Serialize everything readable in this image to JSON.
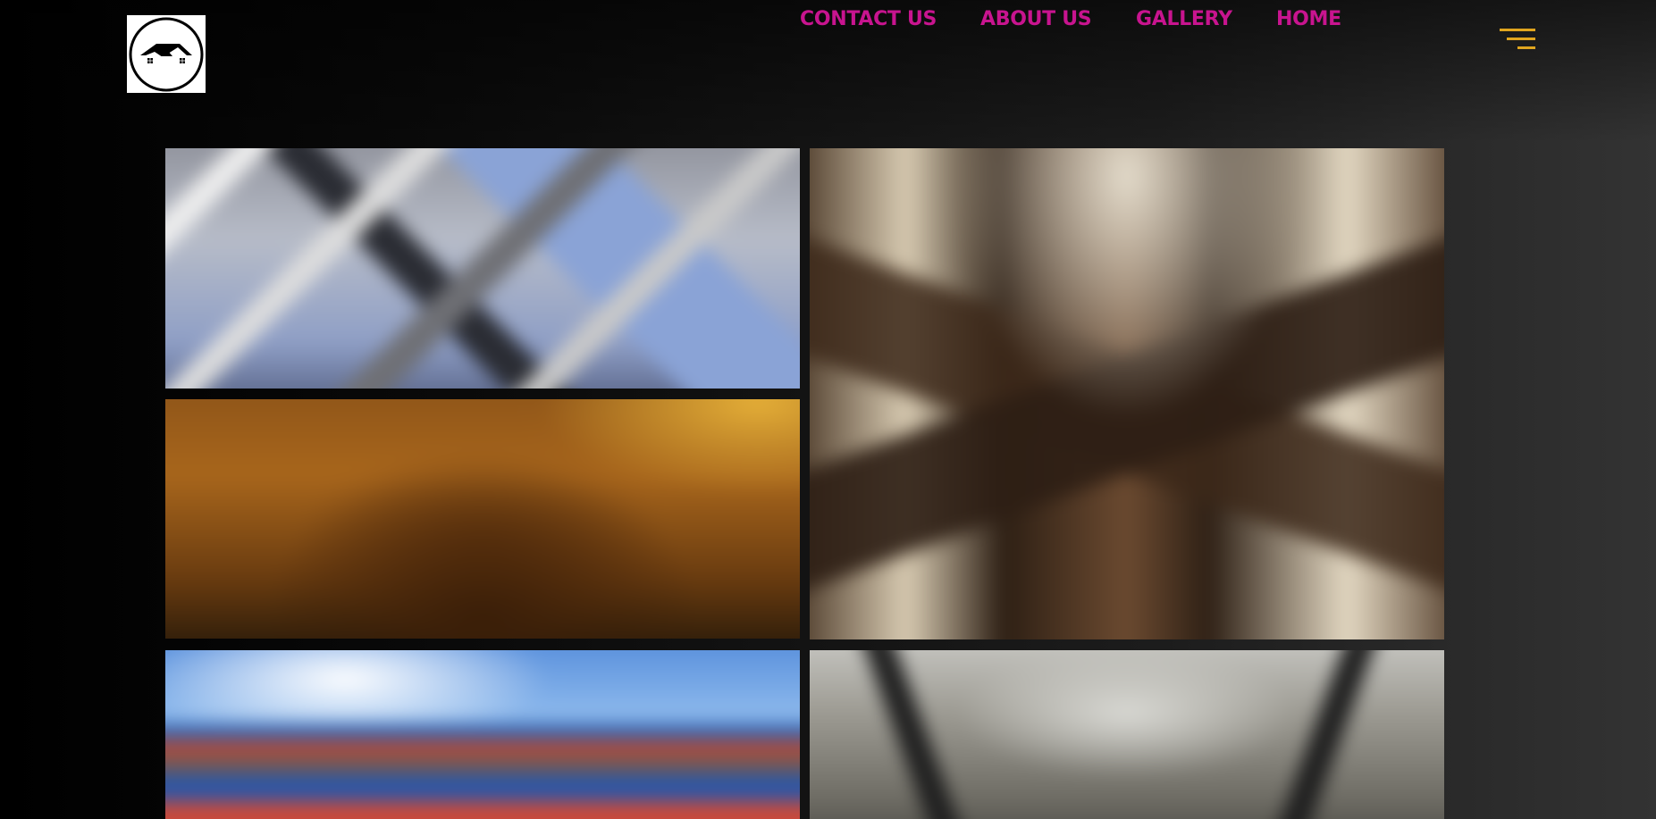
{
  "header": {
    "logo": {
      "icon": "house-roof-icon"
    },
    "nav": {
      "items": [
        {
          "label": "CONTACT US"
        },
        {
          "label": "ABOUT US"
        },
        {
          "label": "GALLERY"
        },
        {
          "label": "HOME"
        }
      ],
      "link_color": "#c8148f"
    },
    "menu": {
      "icon": "hamburger-menu-icon",
      "color": "#e0a51f"
    }
  },
  "gallery": {
    "tiles": [
      {
        "icon": "building-facade-image"
      },
      {
        "icon": "atrium-interior-image"
      },
      {
        "icon": "ornate-ceiling-image"
      },
      {
        "icon": "colorful-buildings-image"
      },
      {
        "icon": "domed-building-image"
      }
    ]
  },
  "theme": {
    "background": "#0b0b0b"
  }
}
